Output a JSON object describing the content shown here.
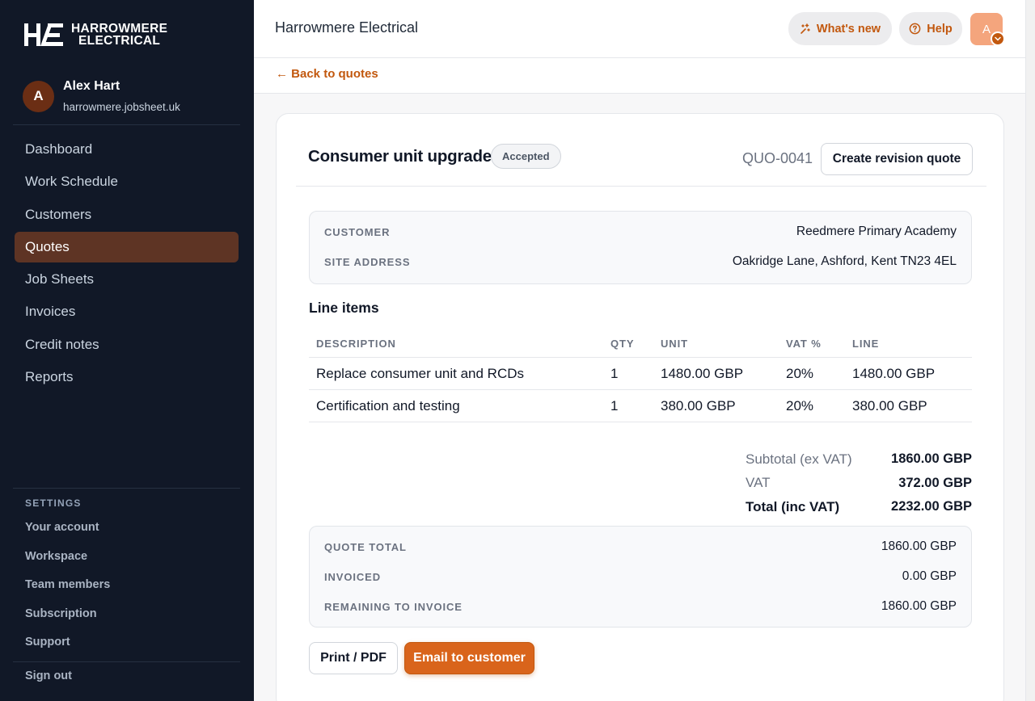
{
  "brand": {
    "line1": "HARROWMERE",
    "line2": "ELECTRICAL",
    "mark": "HE"
  },
  "user": {
    "initial": "A",
    "name": "Alex Hart",
    "domain": "harrowmere.jobsheet.uk"
  },
  "nav": {
    "items": [
      {
        "label": "Dashboard"
      },
      {
        "label": "Work Schedule"
      },
      {
        "label": "Customers"
      },
      {
        "label": "Quotes"
      },
      {
        "label": "Job Sheets"
      },
      {
        "label": "Invoices"
      },
      {
        "label": "Credit notes"
      },
      {
        "label": "Reports"
      }
    ],
    "active": "Quotes"
  },
  "settings": {
    "heading": "SETTINGS",
    "items": [
      {
        "label": "Your account"
      },
      {
        "label": "Workspace"
      },
      {
        "label": "Team members"
      },
      {
        "label": "Subscription"
      },
      {
        "label": "Support"
      }
    ],
    "signout": "Sign out"
  },
  "topbar": {
    "title": "Harrowmere Electrical",
    "whats_new": "What's new",
    "help": "Help",
    "avatar_initial": "A"
  },
  "back_link": "← Back to quotes",
  "quote": {
    "title": "Consumer unit upgrade",
    "status": "Accepted",
    "number": "QUO-0041",
    "revision_button": "Create revision quote"
  },
  "customer_box": {
    "customer_label": "CUSTOMER",
    "customer_value": "Reedmere Primary Academy",
    "site_label": "SITE ADDRESS",
    "site_value": "Oakridge Lane, Ashford, Kent TN23 4EL"
  },
  "line_items": {
    "title": "Line items",
    "headers": {
      "description": "DESCRIPTION",
      "qty": "QTY",
      "unit": "UNIT",
      "vat": "VAT %",
      "line": "LINE"
    },
    "rows": [
      {
        "description": "Replace consumer unit and RCDs",
        "qty": "1",
        "unit": "1480.00 GBP",
        "vat": "20%",
        "line": "1480.00 GBP"
      },
      {
        "description": "Certification and testing",
        "qty": "1",
        "unit": "380.00 GBP",
        "vat": "20%",
        "line": "380.00 GBP"
      }
    ]
  },
  "totals": {
    "subtotal_label": "Subtotal (ex VAT)",
    "subtotal_value": "1860.00 GBP",
    "vat_label": "VAT",
    "vat_value": "372.00 GBP",
    "total_label": "Total (inc VAT)",
    "total_value": "2232.00 GBP"
  },
  "invoice_summary": {
    "quote_total_label": "QUOTE TOTAL",
    "quote_total_value": "1860.00 GBP",
    "invoiced_label": "INVOICED",
    "invoiced_value": "0.00 GBP",
    "remaining_label": "REMAINING TO INVOICE",
    "remaining_value": "1860.00 GBP"
  },
  "actions": {
    "print": "Print / PDF",
    "email": "Email to customer"
  },
  "colors": {
    "accent": "#c2580e",
    "sidebar_bg": "#111827",
    "active_nav": "#5e3424"
  }
}
